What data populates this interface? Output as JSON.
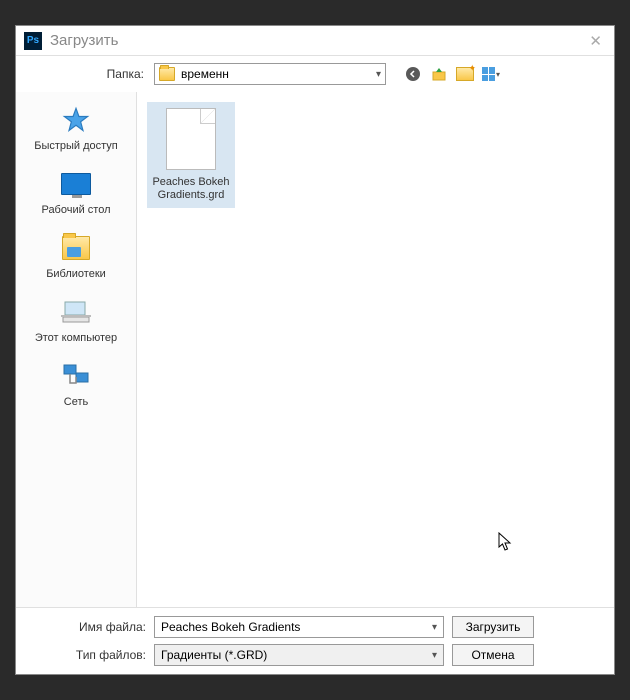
{
  "titlebar": {
    "title": "Загрузить",
    "app_icon_text": "Ps"
  },
  "folder_row": {
    "label": "Папка:",
    "current_folder": "временн"
  },
  "sidebar": {
    "items": [
      {
        "label": "Быстрый доступ"
      },
      {
        "label": "Рабочий стол"
      },
      {
        "label": "Библиотеки"
      },
      {
        "label": "Этот компьютер"
      },
      {
        "label": "Сеть"
      }
    ]
  },
  "file_pane": {
    "files": [
      {
        "name": "Peaches Bokeh Gradients.grd"
      }
    ]
  },
  "bottom": {
    "filename_label": "Имя файла:",
    "filename_value": "Peaches Bokeh Gradients",
    "filetype_label": "Тип файлов:",
    "filetype_value": "Градиенты (*.GRD)",
    "open_label": "Загрузить",
    "cancel_label": "Отмена"
  }
}
